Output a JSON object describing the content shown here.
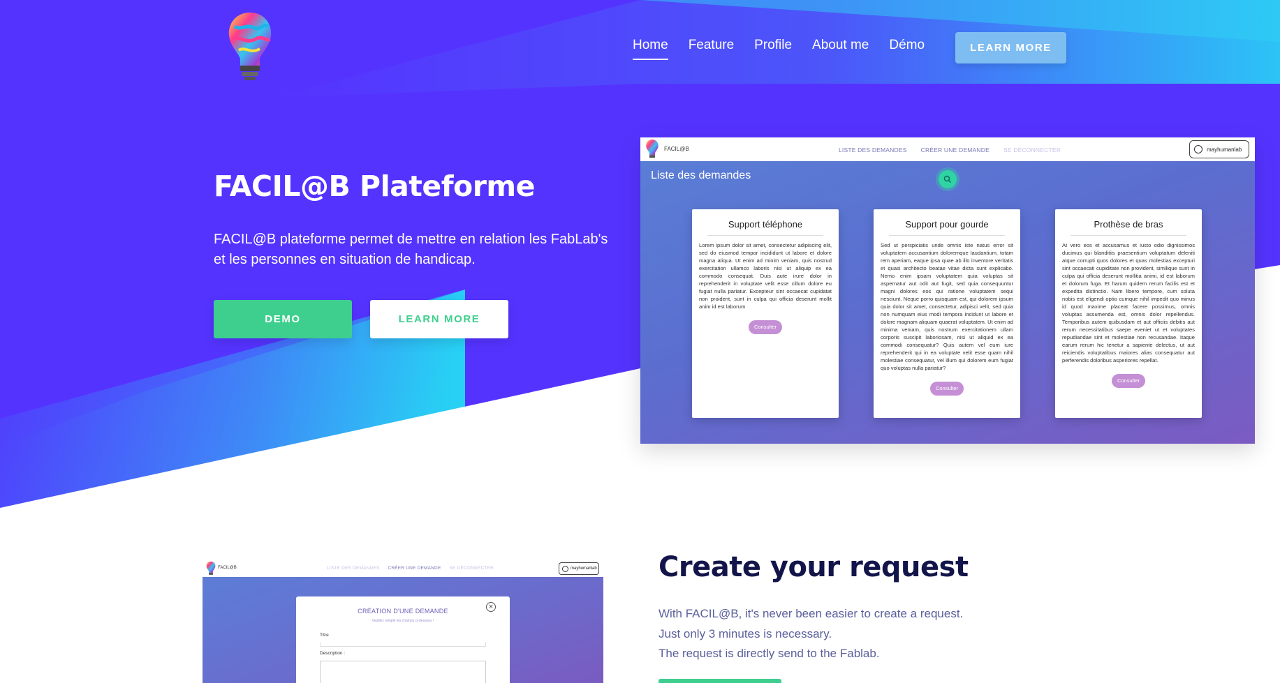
{
  "nav": {
    "links": [
      "Home",
      "Feature",
      "Profile",
      "About me",
      "Démo"
    ],
    "cta": "LEARN MORE"
  },
  "hero": {
    "title": "FACIL@B Plateforme",
    "description_line1": "FACIL@B plateforme permet de mettre en relation les FabLab's",
    "description_line2": "et les personnes en situation de handicap.",
    "demo_button": "DEMO",
    "learn_button": "LEARN MORE"
  },
  "screenshot1": {
    "brand": "FACIL@B",
    "links": [
      "LISTE DES DEMANDES",
      "CRÉER UNE DEMANDE",
      "SE DÉCONNECTER"
    ],
    "user": "mayhumanlab",
    "page_title": "Liste des demandes",
    "cards": [
      {
        "title": "Support téléphone",
        "text": "Lorem ipsum dolor sit amet, consectetur adipiscing elit, sed do eiusmod tempor incididunt ut labore et dolore magna aliqua. Ut enim ad minim veniam, quis nostrud exercitation ullamco laboris nisi ut aliquip ex ea commodo consequat. Duis aute irure dolor in reprehenderit in voluptate velit esse cillum dolore eu fugiat nulla pariatur. Excepteur sint occaecat cupidatat non proident, sunt in culpa qui officia deserunt mollit anim id est laborum",
        "button": "Consulter"
      },
      {
        "title": "Support pour gourde",
        "text": "Sed ut perspiciatis unde omnis iste natus error sit voluptatem accusantium doloremque laudantium, totam rem aperiam, eaque ipsa quae ab illo inventore veritatis et quasi architecto beatae vitae dicta sunt explicabo. Nemo enim ipsam voluptatem quia voluptas sit aspernatur aut odit aut fugit, sed quia consequuntur magni dolores eos qui ratione voluptatem sequi nesciunt. Neque porro quisquam est, qui dolorem ipsum quia dolor sit amet, consectetur, adipisci velit, sed quia non numquam eius modi tempora incidunt ut labore et dolore magnam aliquam quaerat voluptatem. Ut enim ad minima veniam, quis nostrum exercitationem ullam corporis suscipit laboriosam, nisi ut aliquid ex ea commodi consequatur? Quis autem vel eum iure reprehenderit qui in ea voluptate velit esse quam nihil molestiae consequatur, vel illum qui dolorem eum fugiat quo voluptas nulla pariatur?",
        "button": "Consulter"
      },
      {
        "title": "Prothèse de bras",
        "text": "At vero eos et accusamus et iusto odio dignissimos ducimus qui blanditiis praesentium voluptatum deleniti atque corrupti quos dolores et quas molestias excepturi sint occaecati cupiditate non provident, similique sunt in culpa qui officia deserunt mollitia animi, id est laborum et dolorum fuga. Et harum quidem rerum facilis est et expedita distinctio. Nam libero tempore, cum soluta nobis est eligendi optio cumque nihil impedit quo minus id quod maxime placeat facere possimus, omnis voluptas assumenda est, omnis dolor repellendus. Temporibus autem quibusdam et aut officiis debitis aut rerum necessitatibus saepe eveniet ut et voluptates repudiandae sint et molestiae non recusandae. Itaque earum rerum hic tenetur a sapiente delectus, ut aut reiciendis voluptatibus maiores alias consequatur aut perferendis doloribus asperiores repellat.",
        "button": "Consulter"
      }
    ]
  },
  "screenshot2": {
    "brand": "FACIL@B",
    "links": [
      "LISTE DES DEMANDES",
      "CRÉER UNE DEMANDE",
      "SE DÉCONNECTER"
    ],
    "user": "mayhumanlab",
    "modal_title": "CRÉATION D'UNE DEMANDE",
    "modal_sub": "Veuillez remplir les champs ci-dessous !",
    "field_title": "Titre",
    "field_description": "Description :"
  },
  "section": {
    "title": "Create your request",
    "line1": "With FACIL@B, it's never been easier to create a request.",
    "line2": "Just only 3 minutes is necessary.",
    "line3": "The request is directly send to the Fablab."
  },
  "colors": {
    "primary_purple": "#5533ff",
    "accent_cyan": "#25ddf5",
    "green": "#3ecf8e",
    "dark_navy": "#13154a"
  },
  "icons": [
    "lightbulb-logo-icon",
    "search-icon",
    "user-icon",
    "close-icon"
  ]
}
